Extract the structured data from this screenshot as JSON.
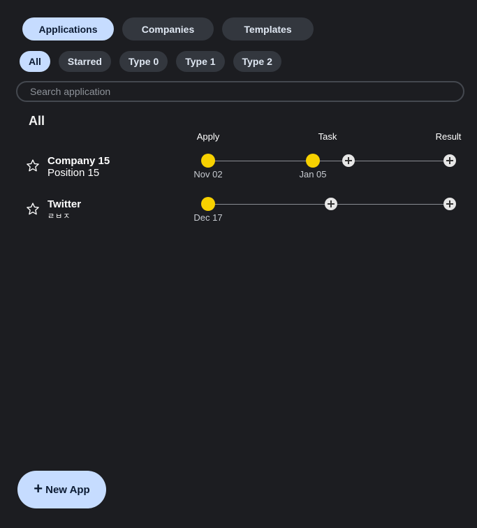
{
  "tabs": [
    {
      "label": "Applications",
      "active": true
    },
    {
      "label": "Companies",
      "active": false
    },
    {
      "label": "Templates",
      "active": false
    }
  ],
  "filters": [
    {
      "label": "All",
      "active": true
    },
    {
      "label": "Starred",
      "active": false
    },
    {
      "label": "Type 0",
      "active": false
    },
    {
      "label": "Type 1",
      "active": false
    },
    {
      "label": "Type 2",
      "active": false
    }
  ],
  "search": {
    "placeholder": "Search application"
  },
  "section_title": "All",
  "stages": [
    "Apply",
    "Task",
    "Result"
  ],
  "applications": [
    {
      "company": "Company 15",
      "position": "Position 15",
      "starred": false,
      "dates": {
        "apply": "Nov 02",
        "task": "Jan 05"
      }
    },
    {
      "company": "Twitter",
      "position": "ㄹㅂㅈ",
      "starred": false,
      "dates": {
        "apply": "Dec 17"
      }
    }
  ],
  "buttons": {
    "new_app": "New App"
  },
  "colors": {
    "background": "#1c1d21",
    "accent": "#c6dcff",
    "chip": "#33373e",
    "milestone": "#f7d100"
  },
  "icons": [
    "star-icon",
    "plus-icon"
  ]
}
